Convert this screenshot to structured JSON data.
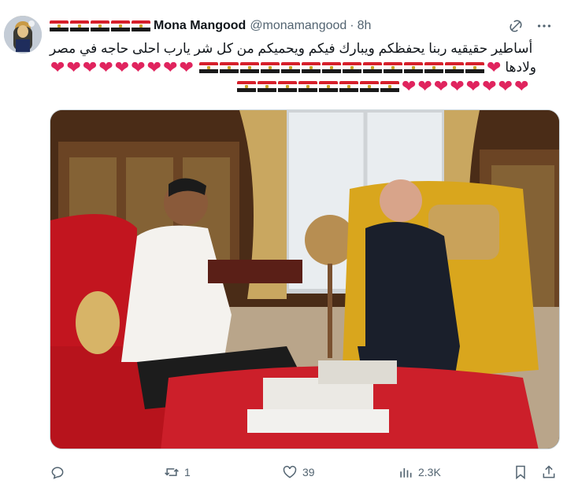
{
  "author": {
    "display_name": "Mona Mangood",
    "handle": "@monamangood",
    "timestamp": "8h",
    "separator": "·"
  },
  "tweet": {
    "text_line1": "أساطير حقيقيه ربنا يحفظكم ويبارك فيكم ويحميكم من كل شر يارب احلى حاجه في مصر",
    "text_line2_prefix": "ولادها",
    "heart_glyph": "❤"
  },
  "stats": {
    "replies": "",
    "reposts": "1",
    "likes": "39",
    "views": "2.3K"
  },
  "icons": {
    "reply": "reply-icon",
    "repost": "repost-icon",
    "like": "heart-icon",
    "views": "views-icon",
    "bookmark": "bookmark-icon",
    "share": "share-icon",
    "grok": "grok-icon",
    "more": "more-icon"
  },
  "colors": {
    "flag_red": "#d61f2b",
    "heart_red": "#e0245e",
    "muted": "#536471"
  }
}
